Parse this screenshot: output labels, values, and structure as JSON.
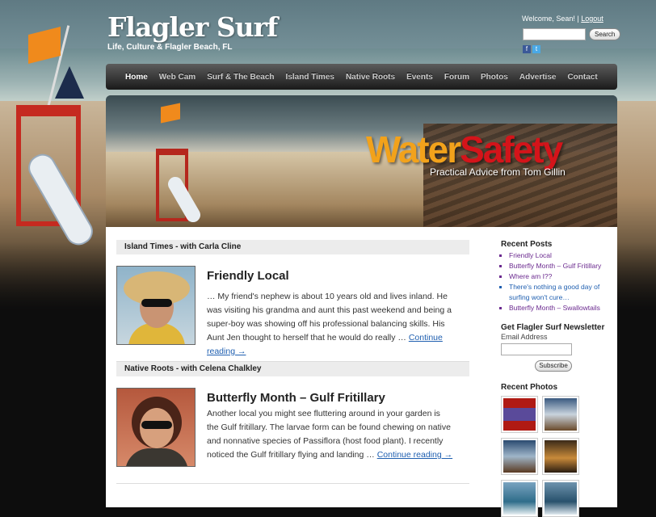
{
  "site": {
    "name": "Flagler Surf",
    "tagline": "Life, Culture & Flagler Beach, FL"
  },
  "user": {
    "welcome": "Welcome, Sean!",
    "separator": "|",
    "logout": "Logout"
  },
  "search": {
    "placeholder": "",
    "button": "Search"
  },
  "social": {
    "facebook": "f",
    "twitter": "t"
  },
  "nav": {
    "items": [
      "Home",
      "Web Cam",
      "Surf & The Beach",
      "Island Times",
      "Native Roots",
      "Events",
      "Forum",
      "Photos",
      "Advertise",
      "Contact"
    ]
  },
  "banner": {
    "title_part1": "Water",
    "title_part2": "Safety",
    "subtitle": "Practical Advice from Tom Gillin"
  },
  "posts": [
    {
      "section": "Island Times - with Carla Cline",
      "title": "Friendly Local",
      "excerpt": "… My friend's nephew is about 10 years old and lives inland.  He was visiting his grandma and aunt this past weekend and being a super-boy was showing off his professional balancing skills.  His Aunt Jen thought to herself that he would do really … ",
      "link": "Continue reading →"
    },
    {
      "section": "Native Roots - with Celena Chalkley",
      "title": "Butterfly Month – Gulf Fritillary",
      "excerpt": "Another local you might see fluttering around in your garden is the Gulf fritillary. The larvae form can be found chewing on native and nonnative species of Passiflora (host food plant). I recently noticed the Gulf fritillary flying and landing … ",
      "link": "Continue reading →"
    }
  ],
  "sidebar": {
    "recent_posts_title": "Recent Posts",
    "recent_posts": [
      "Friendly Local",
      "Butterfly Month – Gulf Fritillary",
      "Where am I??",
      "There's nothing a good day of surfing won't cure…",
      "Butterfly Month – Swallowtails"
    ],
    "newsletter_title": "Get Flagler Surf Newsletter",
    "email_label": "Email Address",
    "subscribe": "Subscribe",
    "photos_title": "Recent Photos"
  },
  "colors": {
    "link": "#1f5fb0",
    "visited": "#6b2a8f",
    "banner_orange": "#f2a21b",
    "banner_red": "#d4141a"
  }
}
